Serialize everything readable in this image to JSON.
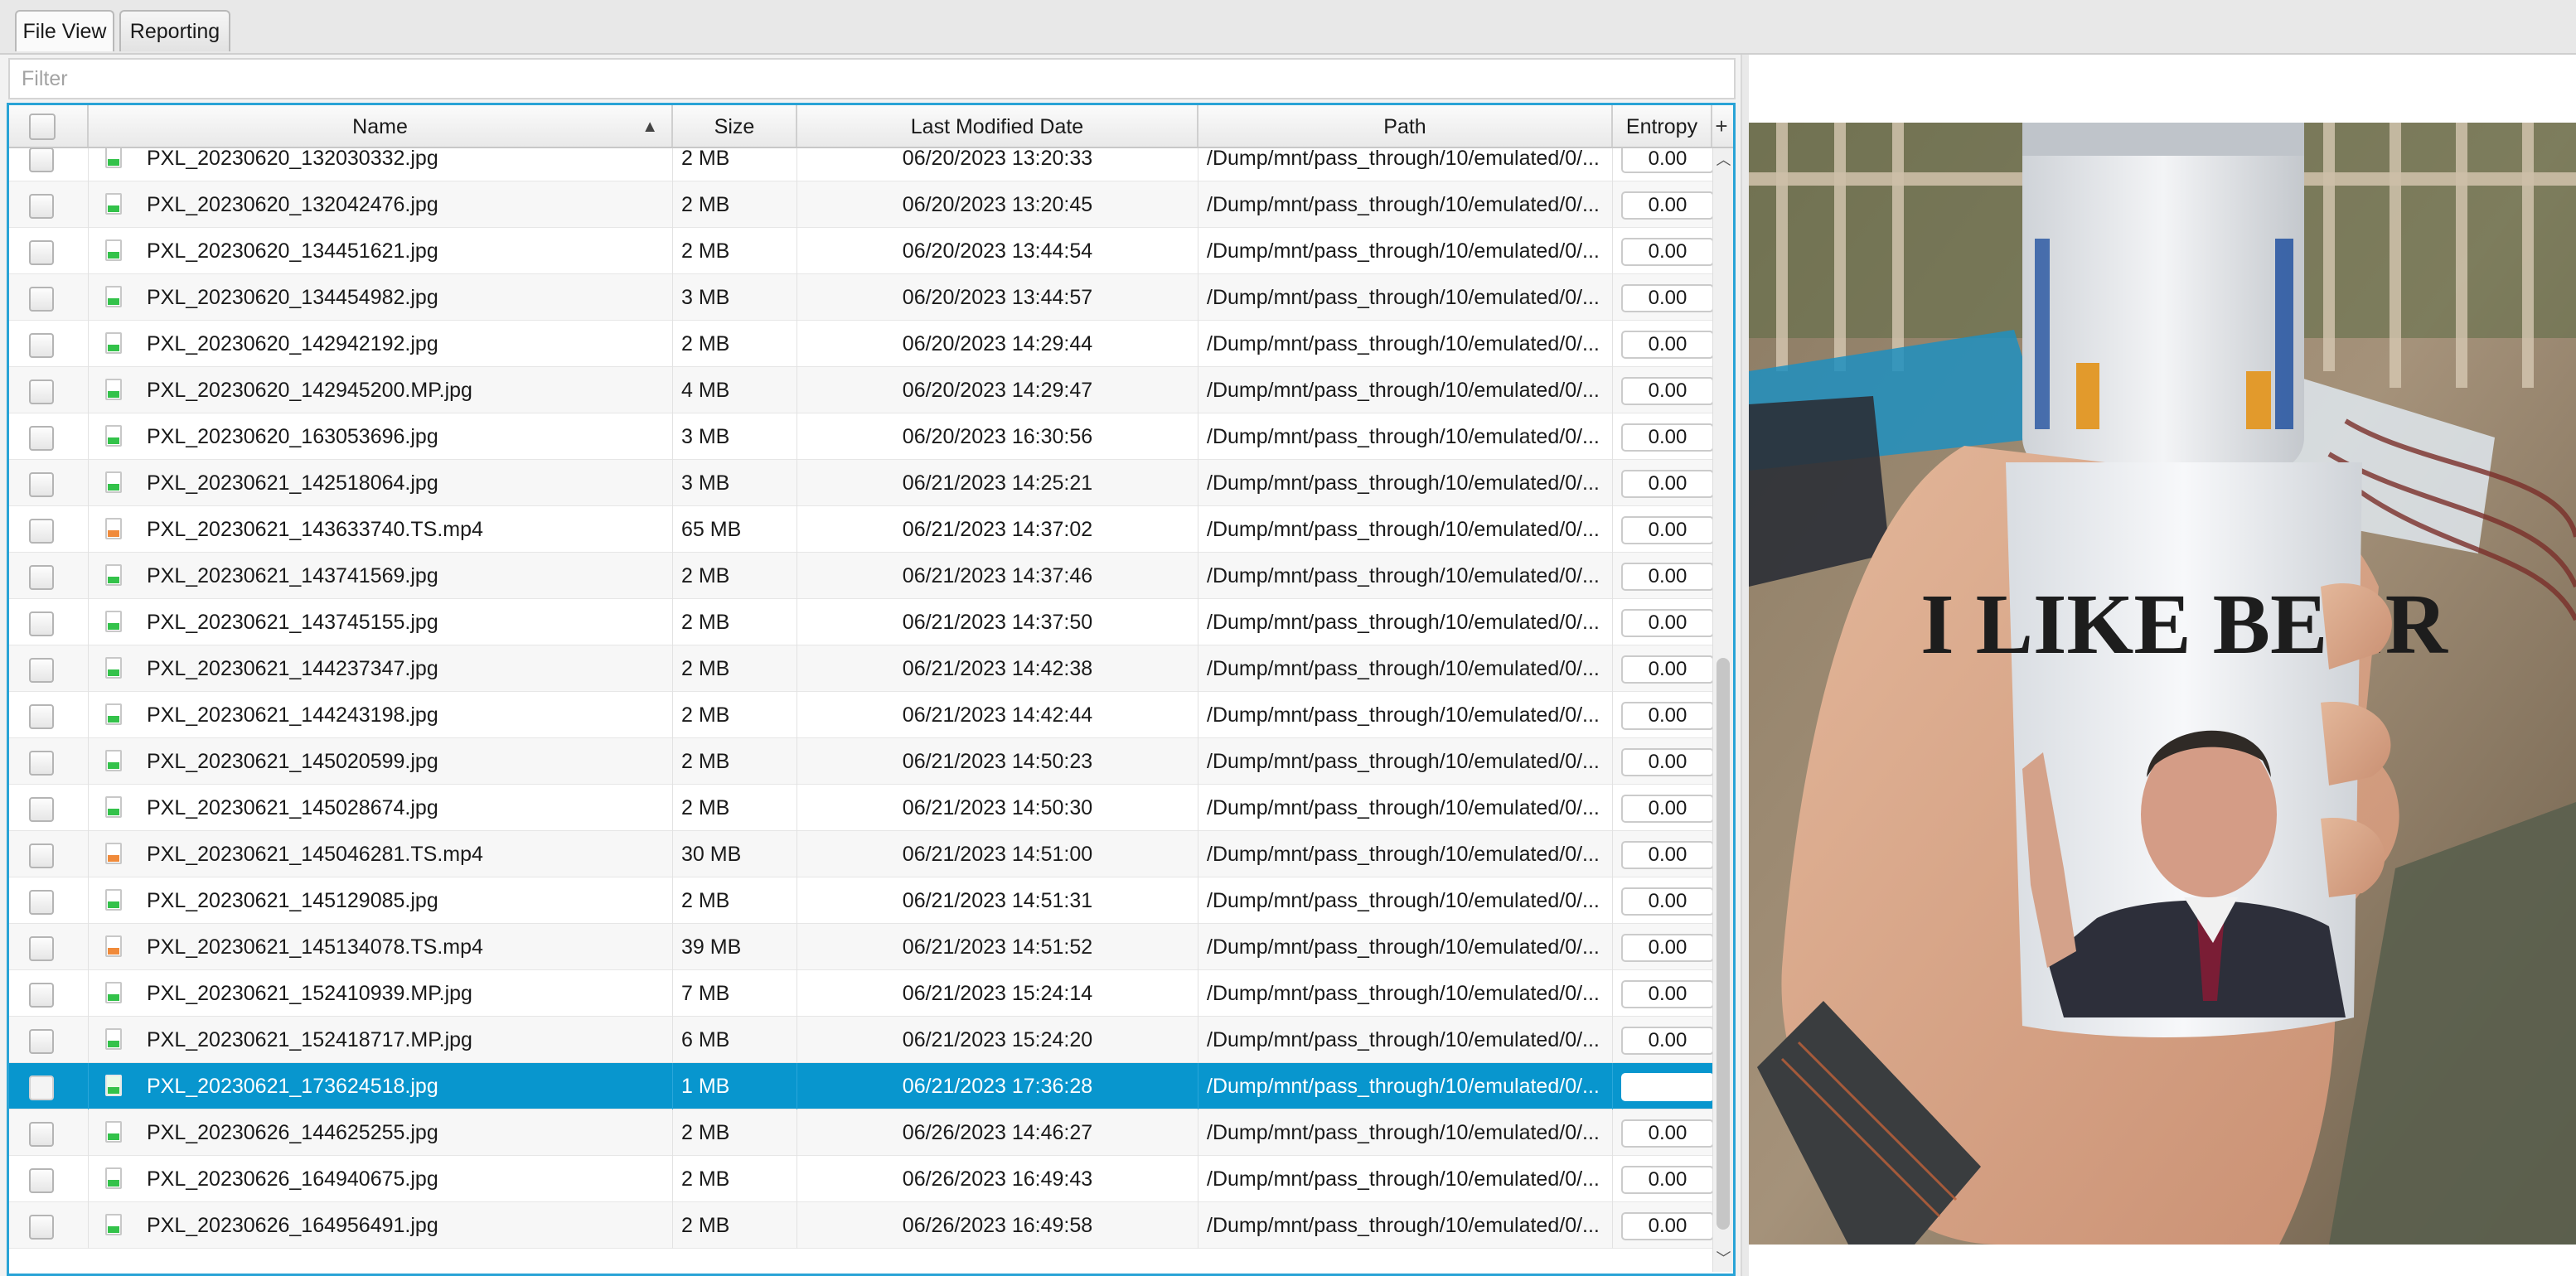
{
  "tabs": [
    {
      "label": "File View",
      "active": true
    },
    {
      "label": "Reporting",
      "active": false
    }
  ],
  "filter": {
    "placeholder": "Filter",
    "value": ""
  },
  "table": {
    "columns": {
      "name": "Name",
      "size": "Size",
      "modified": "Last Modified Date",
      "path": "Path",
      "entropy": "Entropy"
    },
    "sort": {
      "column": "Name",
      "direction": "ascending"
    },
    "rows": [
      {
        "name": "PXL_20230620_132030332.jpg",
        "size": "2 MB",
        "modified": "06/20/2023 13:20:33",
        "path": "/Dump/mnt/pass_through/10/emulated/0/...",
        "entropy": "0.00",
        "type": "image"
      },
      {
        "name": "PXL_20230620_132042476.jpg",
        "size": "2 MB",
        "modified": "06/20/2023 13:20:45",
        "path": "/Dump/mnt/pass_through/10/emulated/0/...",
        "entropy": "0.00",
        "type": "image"
      },
      {
        "name": "PXL_20230620_134451621.jpg",
        "size": "2 MB",
        "modified": "06/20/2023 13:44:54",
        "path": "/Dump/mnt/pass_through/10/emulated/0/...",
        "entropy": "0.00",
        "type": "image"
      },
      {
        "name": "PXL_20230620_134454982.jpg",
        "size": "3 MB",
        "modified": "06/20/2023 13:44:57",
        "path": "/Dump/mnt/pass_through/10/emulated/0/...",
        "entropy": "0.00",
        "type": "image"
      },
      {
        "name": "PXL_20230620_142942192.jpg",
        "size": "2 MB",
        "modified": "06/20/2023 14:29:44",
        "path": "/Dump/mnt/pass_through/10/emulated/0/...",
        "entropy": "0.00",
        "type": "image"
      },
      {
        "name": "PXL_20230620_142945200.MP.jpg",
        "size": "4 MB",
        "modified": "06/20/2023 14:29:47",
        "path": "/Dump/mnt/pass_through/10/emulated/0/...",
        "entropy": "0.00",
        "type": "image"
      },
      {
        "name": "PXL_20230620_163053696.jpg",
        "size": "3 MB",
        "modified": "06/20/2023 16:30:56",
        "path": "/Dump/mnt/pass_through/10/emulated/0/...",
        "entropy": "0.00",
        "type": "image"
      },
      {
        "name": "PXL_20230621_142518064.jpg",
        "size": "3 MB",
        "modified": "06/21/2023 14:25:21",
        "path": "/Dump/mnt/pass_through/10/emulated/0/...",
        "entropy": "0.00",
        "type": "image"
      },
      {
        "name": "PXL_20230621_143633740.TS.mp4",
        "size": "65 MB",
        "modified": "06/21/2023 14:37:02",
        "path": "/Dump/mnt/pass_through/10/emulated/0/...",
        "entropy": "0.00",
        "type": "video"
      },
      {
        "name": "PXL_20230621_143741569.jpg",
        "size": "2 MB",
        "modified": "06/21/2023 14:37:46",
        "path": "/Dump/mnt/pass_through/10/emulated/0/...",
        "entropy": "0.00",
        "type": "image"
      },
      {
        "name": "PXL_20230621_143745155.jpg",
        "size": "2 MB",
        "modified": "06/21/2023 14:37:50",
        "path": "/Dump/mnt/pass_through/10/emulated/0/...",
        "entropy": "0.00",
        "type": "image"
      },
      {
        "name": "PXL_20230621_144237347.jpg",
        "size": "2 MB",
        "modified": "06/21/2023 14:42:38",
        "path": "/Dump/mnt/pass_through/10/emulated/0/...",
        "entropy": "0.00",
        "type": "image"
      },
      {
        "name": "PXL_20230621_144243198.jpg",
        "size": "2 MB",
        "modified": "06/21/2023 14:42:44",
        "path": "/Dump/mnt/pass_through/10/emulated/0/...",
        "entropy": "0.00",
        "type": "image"
      },
      {
        "name": "PXL_20230621_145020599.jpg",
        "size": "2 MB",
        "modified": "06/21/2023 14:50:23",
        "path": "/Dump/mnt/pass_through/10/emulated/0/...",
        "entropy": "0.00",
        "type": "image"
      },
      {
        "name": "PXL_20230621_145028674.jpg",
        "size": "2 MB",
        "modified": "06/21/2023 14:50:30",
        "path": "/Dump/mnt/pass_through/10/emulated/0/...",
        "entropy": "0.00",
        "type": "image"
      },
      {
        "name": "PXL_20230621_145046281.TS.mp4",
        "size": "30 MB",
        "modified": "06/21/2023 14:51:00",
        "path": "/Dump/mnt/pass_through/10/emulated/0/...",
        "entropy": "0.00",
        "type": "video"
      },
      {
        "name": "PXL_20230621_145129085.jpg",
        "size": "2 MB",
        "modified": "06/21/2023 14:51:31",
        "path": "/Dump/mnt/pass_through/10/emulated/0/...",
        "entropy": "0.00",
        "type": "image"
      },
      {
        "name": "PXL_20230621_145134078.TS.mp4",
        "size": "39 MB",
        "modified": "06/21/2023 14:51:52",
        "path": "/Dump/mnt/pass_through/10/emulated/0/...",
        "entropy": "0.00",
        "type": "video"
      },
      {
        "name": "PXL_20230621_152410939.MP.jpg",
        "size": "7 MB",
        "modified": "06/21/2023 15:24:14",
        "path": "/Dump/mnt/pass_through/10/emulated/0/...",
        "entropy": "0.00",
        "type": "image"
      },
      {
        "name": "PXL_20230621_152418717.MP.jpg",
        "size": "6 MB",
        "modified": "06/21/2023 15:24:20",
        "path": "/Dump/mnt/pass_through/10/emulated/0/...",
        "entropy": "0.00",
        "type": "image"
      },
      {
        "name": "PXL_20230621_173624518.jpg",
        "size": "1 MB",
        "modified": "06/21/2023 17:36:28",
        "path": "/Dump/mnt/pass_through/10/emulated/0/...",
        "entropy": "",
        "type": "image",
        "selected": true
      },
      {
        "name": "PXL_20230626_144625255.jpg",
        "size": "2 MB",
        "modified": "06/26/2023 14:46:27",
        "path": "/Dump/mnt/pass_through/10/emulated/0/...",
        "entropy": "0.00",
        "type": "image"
      },
      {
        "name": "PXL_20230626_164940675.jpg",
        "size": "2 MB",
        "modified": "06/26/2023 16:49:43",
        "path": "/Dump/mnt/pass_through/10/emulated/0/...",
        "entropy": "0.00",
        "type": "image"
      },
      {
        "name": "PXL_20230626_164956491.jpg",
        "size": "2 MB",
        "modified": "06/26/2023 16:49:58",
        "path": "/Dump/mnt/pass_through/10/emulated/0/...",
        "entropy": "0.00",
        "type": "image"
      }
    ]
  },
  "preview": {
    "koozie_text": "I LIKE BEER"
  },
  "colors": {
    "selection": "#0896ce",
    "table_border": "#29a3d6",
    "image_icon": "#33c24a",
    "video_icon": "#f08a3a"
  },
  "icons": {
    "image_file": "image-file-icon",
    "video_file": "video-file-icon",
    "sort_ascending": "sort-ascending-icon",
    "add_column": "plus-icon"
  }
}
